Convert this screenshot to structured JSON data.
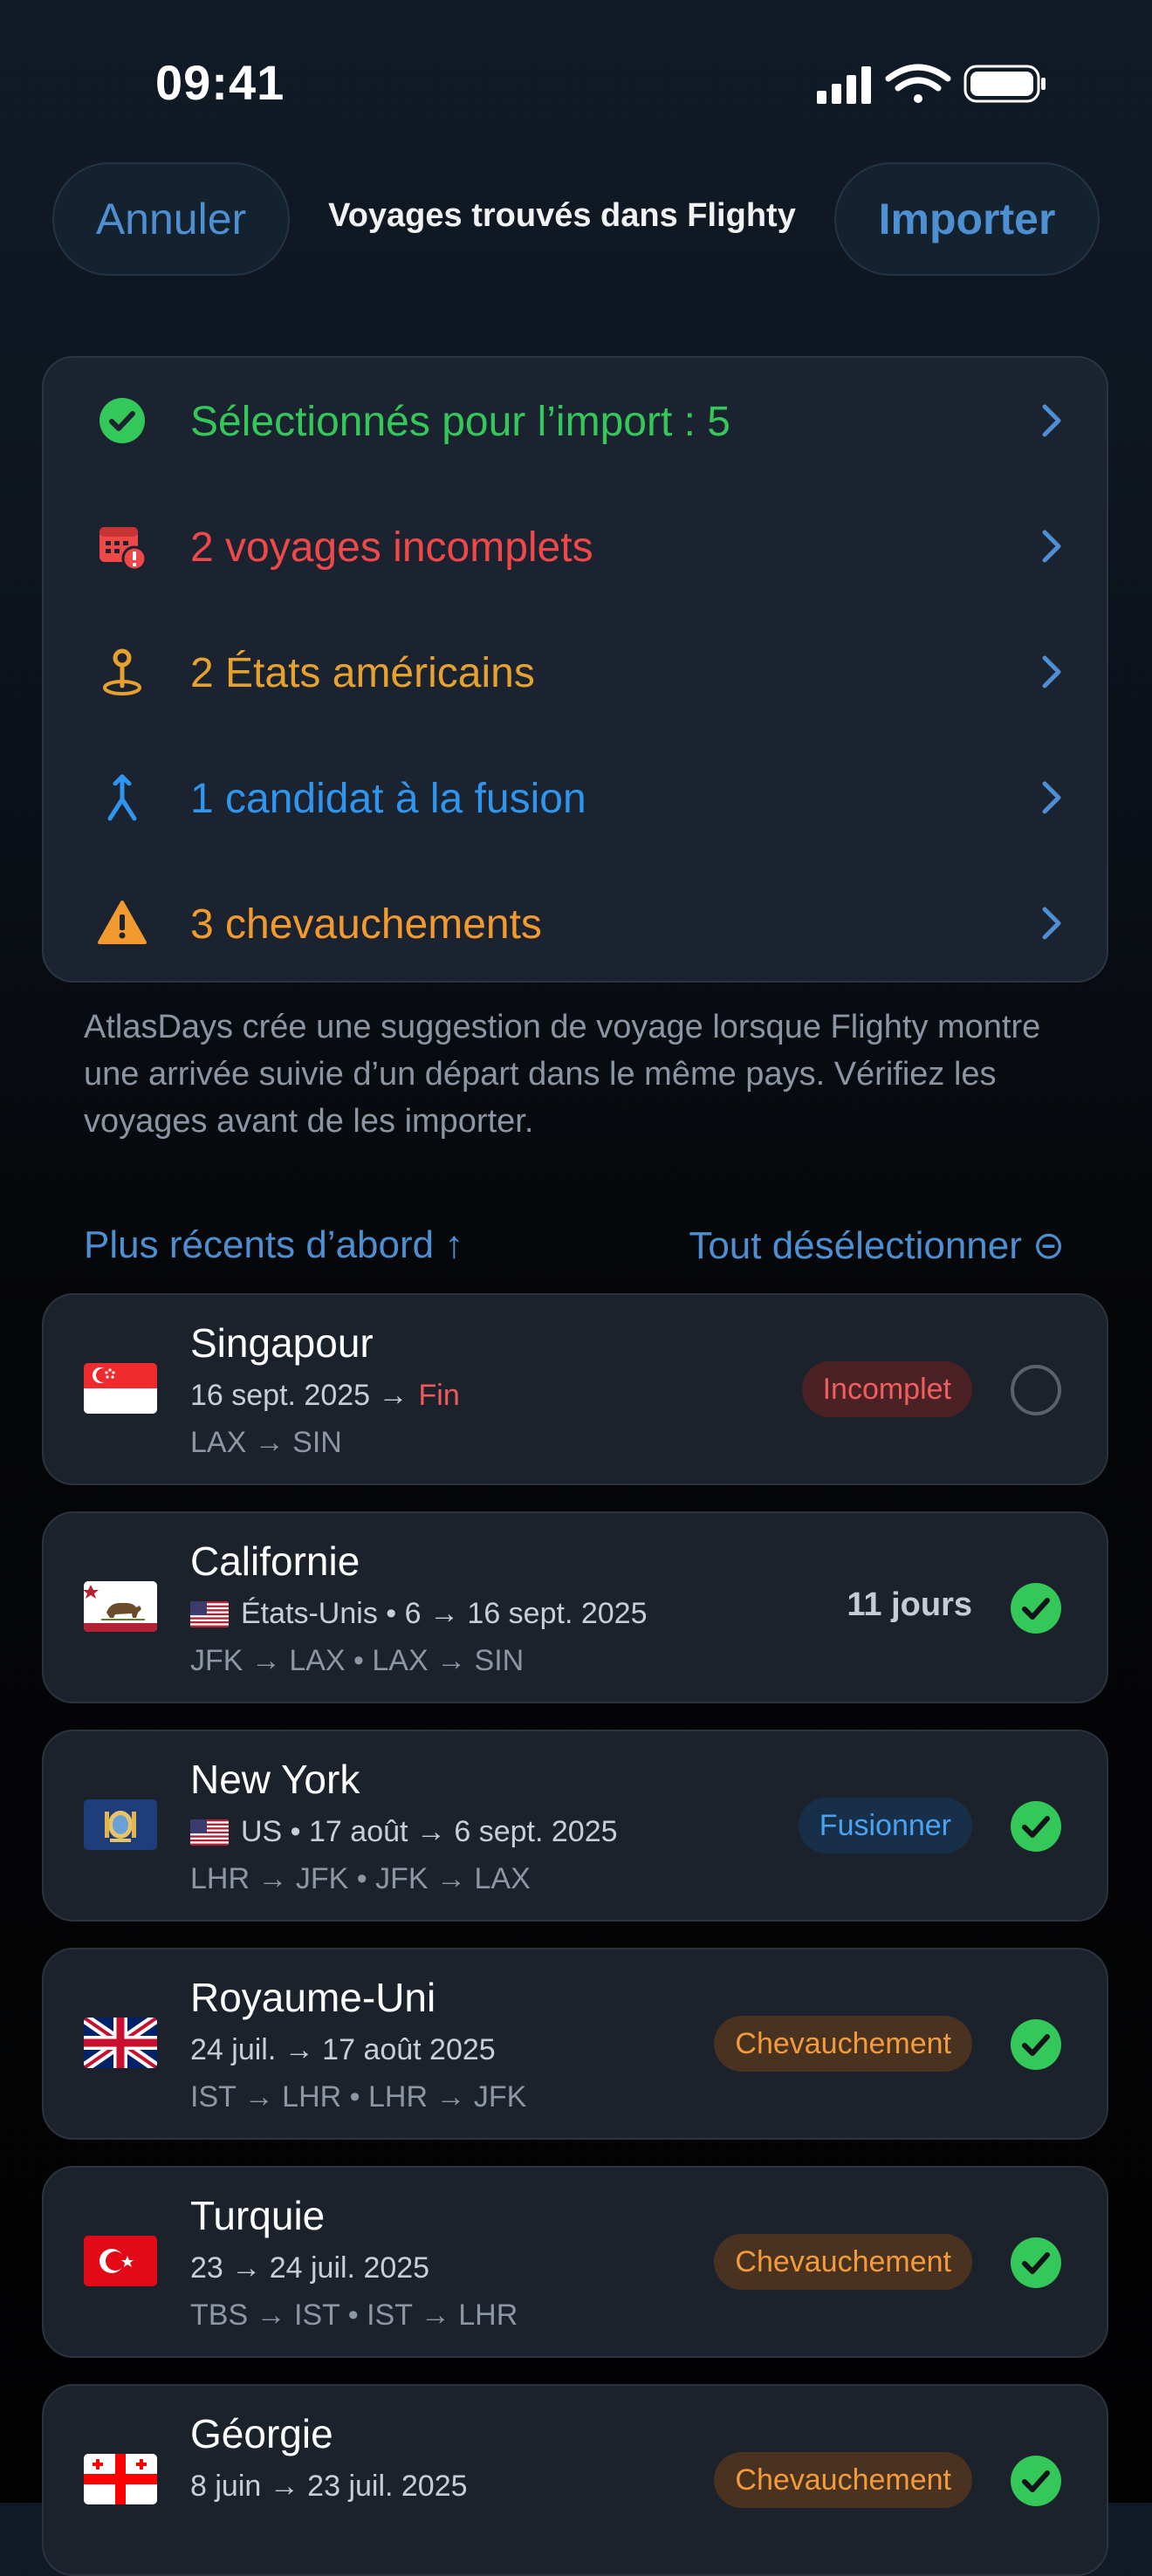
{
  "status_bar": {
    "time": "09:41"
  },
  "header": {
    "cancel_label": "Annuler",
    "title": "Voyages trouvés dans Flighty",
    "import_label": "Importer"
  },
  "summary": [
    {
      "label": "Sélectionnés pour l’import : 5",
      "color": "#34c759",
      "icon": "checkmark-circle-icon"
    },
    {
      "label": "2 voyages incomplets",
      "color": "#f04848",
      "icon": "calendar-alert-icon"
    },
    {
      "label": "2 États américains",
      "color": "#e6a12f",
      "icon": "map-pin-icon"
    },
    {
      "label": "1 candidat à la fusion",
      "color": "#2f96ef",
      "icon": "merge-icon"
    },
    {
      "label": "3 chevauchements",
      "color": "#f29a2e",
      "icon": "warning-triangle-icon"
    }
  ],
  "note": "AtlasDays crée une suggestion de voyage lorsque Flighty montre une arrivée suivie d’un départ dans le même pays. Vérifiez les voyages avant de les importer.",
  "sort_label": "Plus récents d’abord ↑",
  "deselect_label": "Tout désélectionner ⊝",
  "trips": [
    {
      "name": "Singapour",
      "dates": "16 sept. 2025 →",
      "end": "Fin",
      "route": "LAX → SIN",
      "badge": "Incomplet",
      "badge_type": "red",
      "selected": false,
      "flag": "sg-flag-icon"
    },
    {
      "name": "Californie",
      "dates": "États-Unis • 6 → 16 sept. 2025",
      "route": "JFK → LAX • LAX → SIN",
      "days": "11 jours",
      "selected": true,
      "flag": "california-flag-icon"
    },
    {
      "name": "New York",
      "dates": "US • 17 août → 6 sept. 2025",
      "route": "LHR → JFK • JFK → LAX",
      "badge": "Fusionner",
      "badge_type": "blue",
      "selected": true,
      "flag": "new-york-flag-icon"
    },
    {
      "name": "Royaume-Uni",
      "dates": "24 juil. → 17 août 2025",
      "route": "IST → LHR • LHR → JFK",
      "badge": "Chevauchement",
      "badge_type": "orange",
      "selected": true,
      "flag": "uk-flag-icon"
    },
    {
      "name": "Turquie",
      "dates": "23 → 24 juil. 2025",
      "route": "TBS → IST • IST → LHR",
      "badge": "Chevauchement",
      "badge_type": "orange",
      "selected": true,
      "flag": "turkey-flag-icon"
    },
    {
      "name": "Géorgie",
      "dates": "8 juin → 23 juil. 2025",
      "route": "",
      "badge": "Chevauchement",
      "badge_type": "orange",
      "selected": true,
      "flag": "georgia-flag-icon"
    }
  ]
}
